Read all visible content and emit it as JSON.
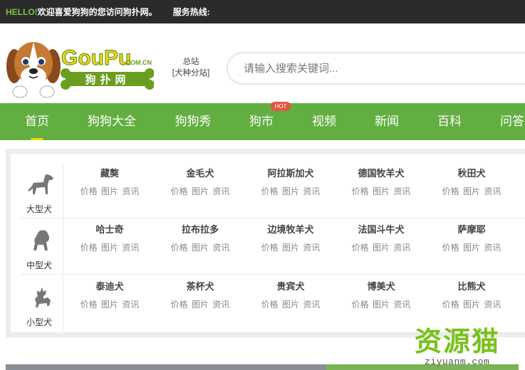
{
  "topbar": {
    "hello": "HELLO!",
    "welcome": "欢迎喜爱狗狗的您访问狗扑网。",
    "hotline": "服务热线:"
  },
  "logo": {
    "brand": "GouPu",
    "domain_suffix": ".COM.CN",
    "chinese_name": "狗扑网"
  },
  "site_switch": {
    "main": "总站",
    "sub": "[犬种分站]"
  },
  "search": {
    "placeholder": "请输入搜索关键词..."
  },
  "nav": {
    "items": [
      {
        "label": "首页",
        "active": true
      },
      {
        "label": "狗狗大全"
      },
      {
        "label": "狗狗秀"
      },
      {
        "label": "狗市",
        "badge": "HOT"
      },
      {
        "label": "视频"
      },
      {
        "label": "新闻"
      },
      {
        "label": "百科"
      },
      {
        "label": "问答"
      }
    ]
  },
  "breeds": {
    "link_labels": [
      "价格",
      "图片",
      "资讯"
    ],
    "categories": [
      {
        "label": "大型犬",
        "icon": "large-dog-icon",
        "items": [
          "藏獒",
          "金毛犬",
          "阿拉斯加犬",
          "德国牧羊犬",
          "秋田犬"
        ]
      },
      {
        "label": "中型犬",
        "icon": "medium-dog-icon",
        "items": [
          "哈士奇",
          "拉布拉多",
          "边境牧羊犬",
          "法国斗牛犬",
          "萨摩耶"
        ]
      },
      {
        "label": "小型犬",
        "icon": "small-dog-icon",
        "items": [
          "泰迪犬",
          "茶杯犬",
          "贵宾犬",
          "博美犬",
          "比熊犬"
        ]
      }
    ]
  },
  "watermark": {
    "big": "资源猫",
    "small": "ziyuanm.com"
  },
  "colors": {
    "nav_green": "#62ae41",
    "hello_green": "#7cc242",
    "hot_red": "#e05548",
    "active_underline": "#f5d400"
  }
}
